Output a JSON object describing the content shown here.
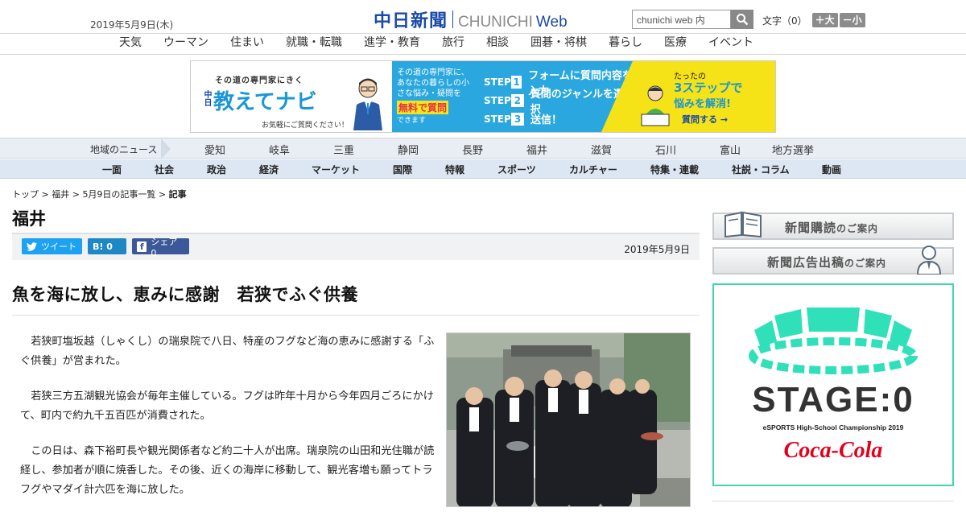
{
  "header": {
    "date": "2019年5月9日(木)",
    "logo_ja": "中日新聞",
    "logo_en": "CHUNICHI",
    "logo_web": "Web",
    "search_value": "chunichi web 内",
    "textsize_label": "文字（0）",
    "textsize_up": "＋大",
    "textsize_down": "－小"
  },
  "categories": [
    "天気",
    "ウーマン",
    "住まい",
    "就職・転職",
    "進学・教育",
    "旅行",
    "相談",
    "囲碁・将棋",
    "暮らし",
    "医療",
    "イベント"
  ],
  "banner": {
    "kicker": "その道の専門家にきく",
    "brand_small": "中日",
    "brand": "教えてナビ",
    "note": "お気軽にご質問ください！",
    "mid_text": "その道の専門家に、あなたの暮らしの小さな悩み・疑問を",
    "free": "無料で質問",
    "mid_small": "できます",
    "step_label": "STEP",
    "steps": [
      {
        "num": "1",
        "text": "フォームに質問内容を入力"
      },
      {
        "num": "2",
        "text": "質問のジャンルを選択"
      },
      {
        "num": "3",
        "text": "送信！"
      }
    ],
    "right_kicker": "たったの",
    "right_title": "3ステップで",
    "right_title2": "悩みを解消!",
    "right_button": "質問する →"
  },
  "region_nav": {
    "label": "地域のニュース",
    "items": [
      "愛知",
      "岐阜",
      "三重",
      "静岡",
      "長野",
      "福井",
      "滋賀",
      "石川",
      "富山",
      "地方選挙"
    ]
  },
  "section_nav": [
    "一面",
    "社会",
    "政治",
    "経済",
    "マーケット",
    "国際",
    "特報",
    "スポーツ",
    "カルチャー",
    "特集・連載",
    "社説・コラム",
    "動画"
  ],
  "breadcrumb": {
    "top": "トップ",
    "pref": "福井",
    "list": "5月9日の記事一覧",
    "current": "記事",
    "sep": " > "
  },
  "article": {
    "prefecture": "福井",
    "share": {
      "tweet": "ツイート",
      "hatena": "B! 0",
      "facebook": "シェア 0"
    },
    "date": "2019年5月9日",
    "headline": "魚を海に放し、恵みに感謝　若狭でふぐ供養",
    "paragraphs": [
      "若狭町塩坂越（しゃくし）の瑞泉院で八日、特産のフグなど海の恵みに感謝する「ふぐ供養」が営まれた。",
      "若狭三方五湖観光協会が毎年主催している。フグは昨年十月から今年四月ごろにかけて、町内で約九千五百匹が消費された。",
      "この日は、森下裕町長や観光関係者など約二十人が出席。瑞泉院の山田和光住職が読経し、参加者が順に焼香した。その後、近くの海岸に移動して、観光客増も願ってトラフグやマダイ計六匹を海に放した。"
    ]
  },
  "sidebar": {
    "subscribe_main": "新聞購読",
    "subscribe_sub": "のご案内",
    "ad_main": "新聞広告出稿",
    "ad_sub": "のご案内",
    "stage_title": "STAGE:0",
    "stage_sub": "eSPORTS High-School Championship 2019",
    "sponsor": "Coca-Cola"
  },
  "colors": {
    "brand_blue": "#1a4aa8",
    "twitter": "#1da1f2",
    "hatena": "#1e88c4",
    "facebook": "#3b5998",
    "stage_green": "#44d4b0",
    "coke_red": "#e3001b"
  }
}
